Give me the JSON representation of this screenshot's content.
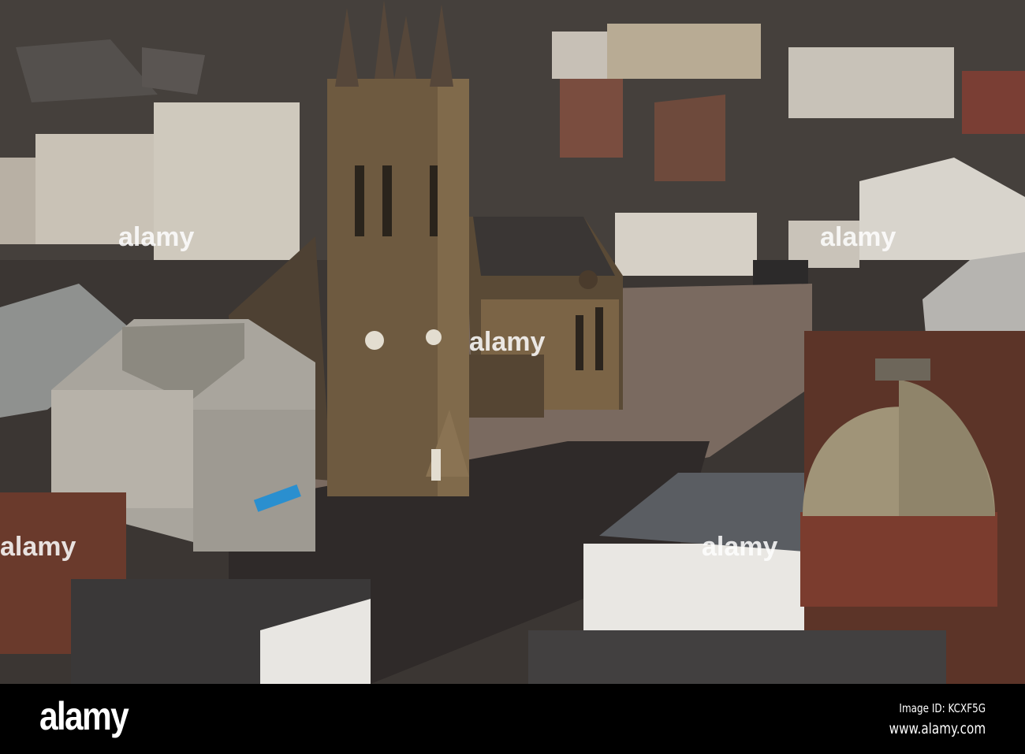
{
  "photo": {
    "subject": "Aerial view of town square with church tower",
    "watermark": "alamy"
  },
  "footer": {
    "logo": "alamy",
    "image_id": "Image ID: KCXF5G",
    "website": "www.alamy.com"
  },
  "colors": {
    "rooftops": "#3b3633",
    "plaza_lit": "#7a6a60",
    "plaza_shadow": "#2f2a29",
    "sandstone": "#6e5a40",
    "office": "#a9a59d",
    "dome": "#a09478",
    "brick": "#6a3a2c"
  }
}
